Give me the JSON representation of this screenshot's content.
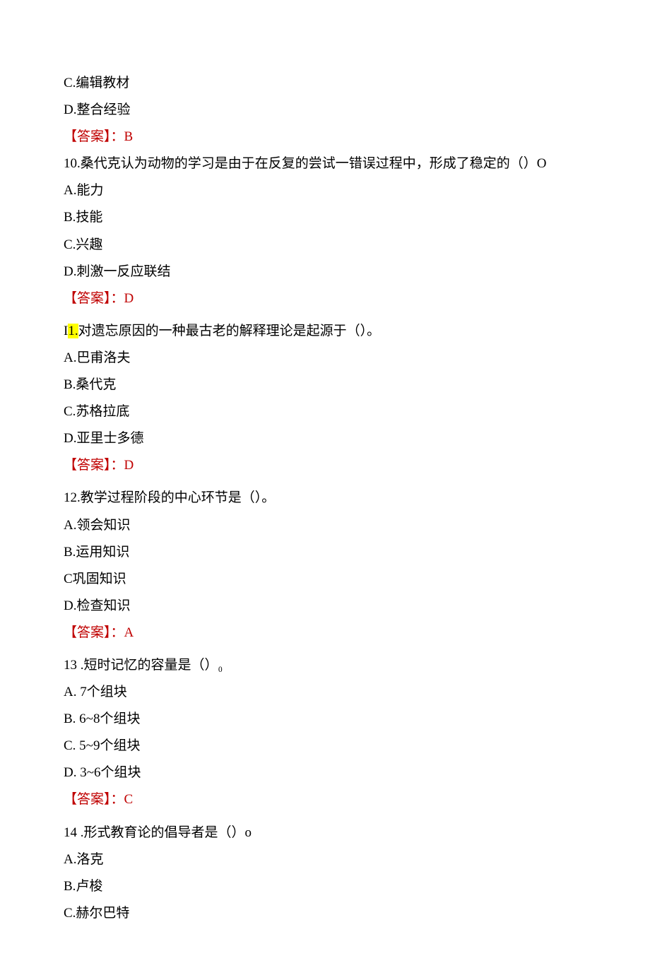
{
  "lines": {
    "q9_c": "C.编辑教材",
    "q9_d": "D.整合经验",
    "q9_ans": "【答案】：B",
    "q10_stem": "10.桑代克认为动物的学习是由于在反复的尝试一错误过程中，形成了稳定的（）O",
    "q10_a": "A.能力",
    "q10_b": "B.技能",
    "q10_c": "C.兴趣",
    "q10_d": "D.刺激一反应联结",
    "q10_ans": "【答案】：D",
    "q11_prefix": "I",
    "q11_hl": "1.",
    "q11_rest": "对遗忘原因的一种最古老的解释理论是起源于（）。",
    "q11_a": "A.巴甫洛夫",
    "q11_b": "B.桑代克",
    "q11_c": "C.苏格拉底",
    "q11_d": "D.亚里士多德",
    "q11_ans": "【答案】：D",
    "q12_stem": "12.教学过程阶段的中心环节是（）。",
    "q12_a": "A.领会知识",
    "q12_b": "B.运用知识",
    "q12_c": "C巩固知识",
    "q12_d": "D.检查知识",
    "q12_ans": "【答案】：A",
    "q13_stem": "13 .短时记忆的容量是（）₀",
    "q13_a": "A. 7个组块",
    "q13_b": "B. 6~8个组块",
    "q13_c": "C. 5~9个组块",
    "q13_d": "D. 3~6个组块",
    "q13_ans": "【答案】：C",
    "q14_stem": "14 .形式教育论的倡导者是（）o",
    "q14_a": "A.洛克",
    "q14_b": "B.卢梭",
    "q14_c": "C.赫尔巴特"
  }
}
